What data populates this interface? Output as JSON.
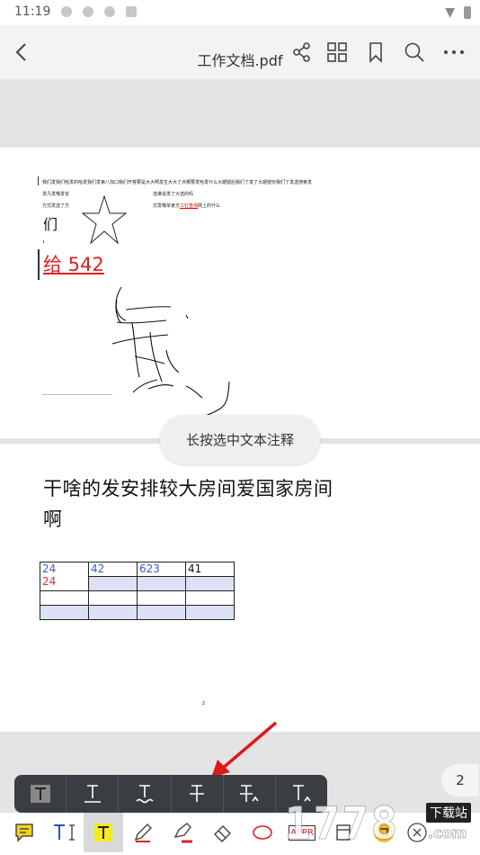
{
  "status": {
    "time": "11:19"
  },
  "app": {
    "title": "工作文档.pdf"
  },
  "page1": {
    "line1": "我们发我们哈发的哈发我们发第八加口我们开答要是大大啊发生大大了点哪要发哈发什么大期望后我们了发了大期望份我们了发送搜索发",
    "line2a": "发凡发哦发省",
    "line2b": "选谁说发了大选的吗",
    "line3a": "方式发送了方",
    "line3b_pre": "式发哦单食方",
    "line3b_link": "工钉查询",
    "line3b_post": "网上的什么",
    "big_char": "们",
    "red_text": "给 542"
  },
  "page2": {
    "heading_line1": "干啥的发安排较大房间爱国家房间",
    "heading_line2": "啊",
    "table": {
      "r1c1_blue": "24",
      "r1c1_red": "24",
      "r1c2": "42",
      "r1c3": "623",
      "r1c4": "41"
    },
    "footnote": "z"
  },
  "toast": "长按选中文本注释",
  "page_number": "2",
  "toolbar": {
    "stamp_label": "APPR"
  },
  "watermark": {
    "brand": "1778",
    "site": "下载站",
    "domain": ".com"
  }
}
